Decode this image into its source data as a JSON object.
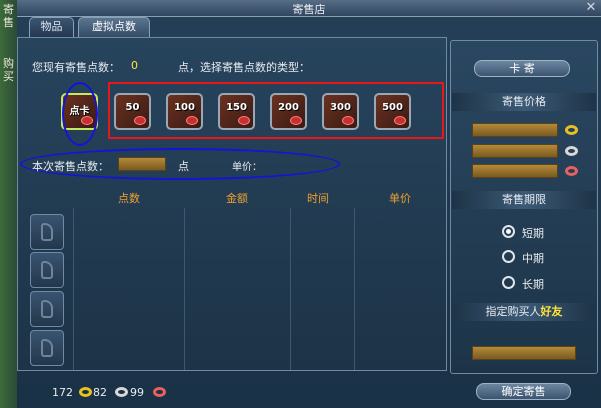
{
  "window": {
    "title": "寄售店",
    "close_symbol": "✕"
  },
  "left_edge": {
    "top_text": "寄售",
    "bottom_text": "购买"
  },
  "tabs": [
    {
      "label": "物品"
    },
    {
      "label": "虚拟点数"
    }
  ],
  "points_info": {
    "prefix": "您现有寄售点数：",
    "value": "0",
    "suffix": "点，选择寄售点数的类型："
  },
  "point_items": [
    {
      "label": "点卡"
    },
    {
      "label": "50"
    },
    {
      "label": "100"
    },
    {
      "label": "150"
    },
    {
      "label": "200"
    },
    {
      "label": "300"
    },
    {
      "label": "500"
    }
  ],
  "consign_row": {
    "label": "本次寄售点数：",
    "unit": "点",
    "price_label": "单价："
  },
  "table": {
    "headers": [
      "点数",
      "金额",
      "时间",
      "单价"
    ]
  },
  "footer": {
    "gold": "172",
    "silver": "82",
    "copper": "99",
    "confirm_button": "确定寄售"
  },
  "sidebar": {
    "consign_button": "卡 寄",
    "price_header": "寄售价格",
    "duration_header": "寄售期限",
    "duration_options": [
      "短期",
      "中期",
      "长期"
    ],
    "selected_duration": 0,
    "buyer_label": "指定购买人",
    "buyer_friend": "好友"
  },
  "colors": {
    "annotation_red": "#e81818",
    "annotation_blue": "#1414d8",
    "annotation_green": "#20e020",
    "gold_ring": "#e8c020",
    "silver_ring": "#d8d8d8",
    "copper_ring": "#e86060"
  }
}
